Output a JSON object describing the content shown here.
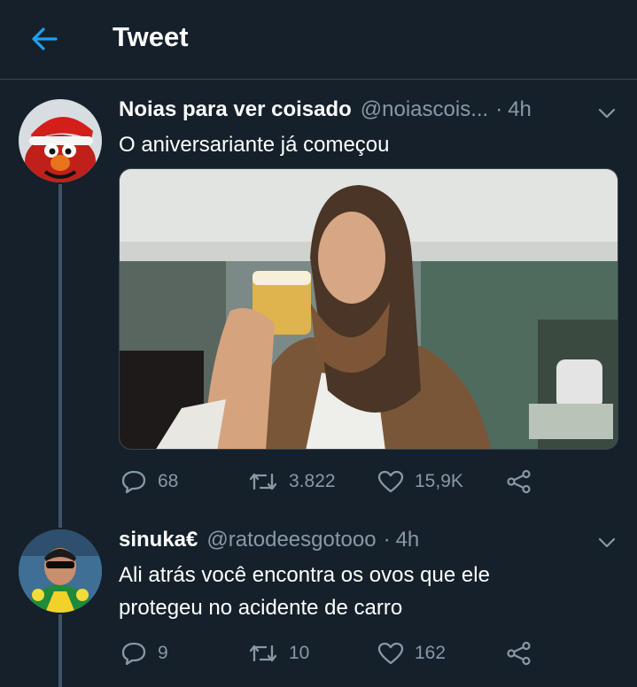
{
  "header": {
    "title": "Tweet"
  },
  "tweets": [
    {
      "display_name": "Noias para ver coisado",
      "handle": "@noiascois...",
      "dot": "·",
      "time": "4h",
      "text": "O aniversariante já começou",
      "avatar_icon": "elmo-santa-hat-avatar",
      "media_icon": "man-drinking-beer-photo",
      "stats": {
        "replies": "68",
        "retweets": "3.822",
        "likes": "15,9K"
      }
    },
    {
      "display_name": "sinuka€",
      "handle": "@ratodeesgotooo",
      "dot": "·",
      "time": "4h",
      "text_line1": "Ali atrás você encontra os ovos que ele",
      "text_line2": "protegeu no acidente de carro",
      "avatar_icon": "sunglasses-man-avatar",
      "stats": {
        "replies": "9",
        "retweets": "10",
        "likes": "162"
      }
    }
  ],
  "colors": {
    "background": "#15202b",
    "accent": "#1da1f2",
    "muted": "#8899a6",
    "divider": "#38444d"
  }
}
